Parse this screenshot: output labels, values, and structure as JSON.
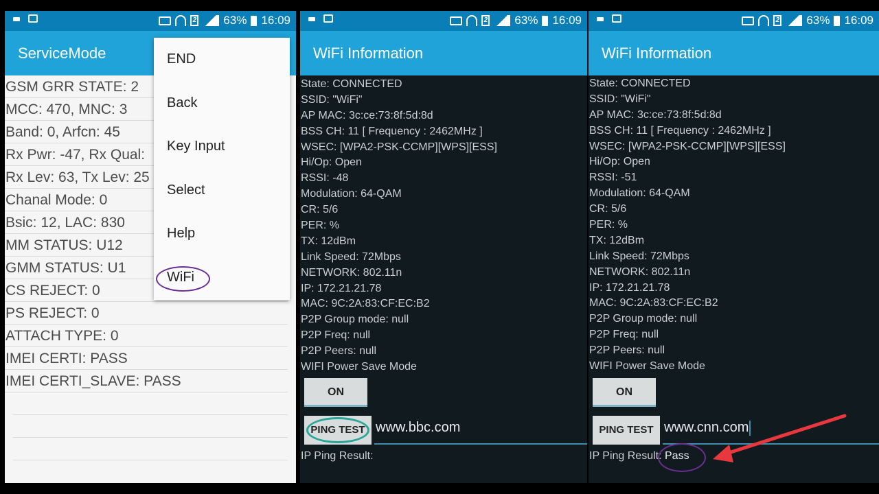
{
  "status_bar": {
    "battery": "63%",
    "time": "16:09"
  },
  "service_mode": {
    "title": "ServiceMode",
    "rows": [
      "GSM GRR STATE: 2",
      "MCC: 470, MNC: 3",
      "Band: 0, Arfcn: 45",
      "Rx Pwr: -47, Rx Qual:",
      "Rx Lev: 63, Tx Lev: 25",
      "Chanal Mode: 0",
      "Bsic: 12, LAC: 830",
      "MM STATUS: U12",
      "GMM STATUS: U1",
      "CS REJECT: 0",
      "PS REJECT: 0",
      "ATTACH TYPE: 0",
      "IMEI CERTI: PASS",
      "IMEI CERTI_SLAVE: PASS"
    ],
    "menu": [
      "END",
      "Back",
      "Key Input",
      "Select",
      "Help",
      "WiFi"
    ]
  },
  "wifi_bbc": {
    "title": "WiFi Information",
    "rows": [
      "State: CONNECTED",
      "SSID: \"WiFi\"",
      "AP MAC: 3c:ce:73:8f:5d:8d",
      "BSS CH: 11  [ Frequency : 2462MHz ]",
      "WSEC: [WPA2-PSK-CCMP][WPS][ESS]",
      "Hi/Op: Open",
      "RSSI: -48",
      "Modulation: 64-QAM",
      "CR: 5/6",
      "PER:  %",
      "TX: 12dBm",
      "Link Speed: 72Mbps",
      "NETWORK: 802.11n",
      "IP: 172.21.21.78",
      "MAC: 9C:2A:83:CF:EC:B2",
      "P2P Group mode: null",
      "P2P Freq: null",
      "P2P Peers: null",
      "WIFI Power Save Mode"
    ],
    "on_button": "ON",
    "ping_button": "PING TEST",
    "url": "www.bbc.com",
    "result_label": "IP Ping Result:",
    "result_value": ""
  },
  "wifi_cnn": {
    "title": "WiFi Information",
    "rows": [
      "State: CONNECTED",
      "SSID: \"WiFi\"",
      "AP MAC: 3c:ce:73:8f:5d:8d",
      "BSS CH: 11  [ Frequency : 2462MHz ]",
      "WSEC: [WPA2-PSK-CCMP][WPS][ESS]",
      "Hi/Op: Open",
      "RSSI: -51",
      "Modulation: 64-QAM",
      "CR: 5/6",
      "PER:  %",
      "TX: 12dBm",
      "Link Speed: 72Mbps",
      "NETWORK: 802.11n",
      "IP: 172.21.21.78",
      "MAC: 9C:2A:83:CF:EC:B2",
      "P2P Group mode: null",
      "P2P Freq: null",
      "P2P Peers: null",
      "WIFI Power Save Mode"
    ],
    "on_button": "ON",
    "ping_button": "PING TEST",
    "url": "www.cnn.com",
    "result_label": "IP Ping Result:",
    "result_value": "Pass"
  },
  "colors": {
    "status_bar": "#0a7eb6",
    "app_bar": "#1fa3d8",
    "highlight_ring": "#6a2f91",
    "annotation_arrow": "#e8383d"
  }
}
